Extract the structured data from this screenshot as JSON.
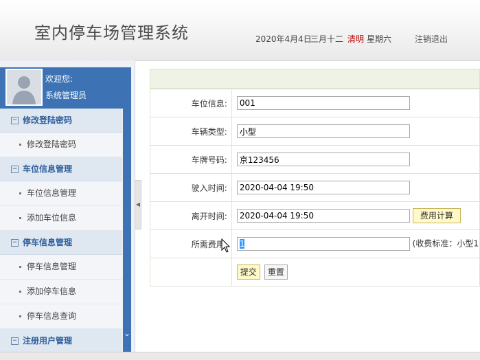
{
  "header": {
    "app_title": "室内停车场管理系统",
    "date": "2020年4月4日",
    "lunar": "三月十二",
    "festival": "清明",
    "weekday": "星期六",
    "logout": "注销退出",
    "festival_color": "#c00000"
  },
  "sidebar": {
    "welcome": "欢迎您:",
    "role": "系统管理员",
    "groups": [
      {
        "label": "修改登陆密码",
        "items": [
          "修改登陆密码"
        ]
      },
      {
        "label": "车位信息管理",
        "items": [
          "车位信息管理",
          "添加车位信息"
        ]
      },
      {
        "label": "停车信息管理",
        "items": [
          "停车信息管理",
          "添加停车信息",
          "停车信息查询"
        ]
      },
      {
        "label": "注册用户管理",
        "items": []
      }
    ],
    "toggle_icon": "⊟",
    "accent_color": "#3d73b4"
  },
  "form": {
    "fields": [
      {
        "label": "车位信息:",
        "value": "001"
      },
      {
        "label": "车辆类型:",
        "value": "小型"
      },
      {
        "label": "车牌号码:",
        "value": "京123456"
      },
      {
        "label": "驶入时间:",
        "value": "2020-04-04 19:50"
      },
      {
        "label": "离开时间:",
        "value": "2020-04-04 19:50"
      },
      {
        "label": "所需费用:",
        "value": "1"
      }
    ],
    "calc_button": "费用计算",
    "fee_note": "(收费标准：小型1",
    "submit": "提交",
    "reset": "重置"
  }
}
